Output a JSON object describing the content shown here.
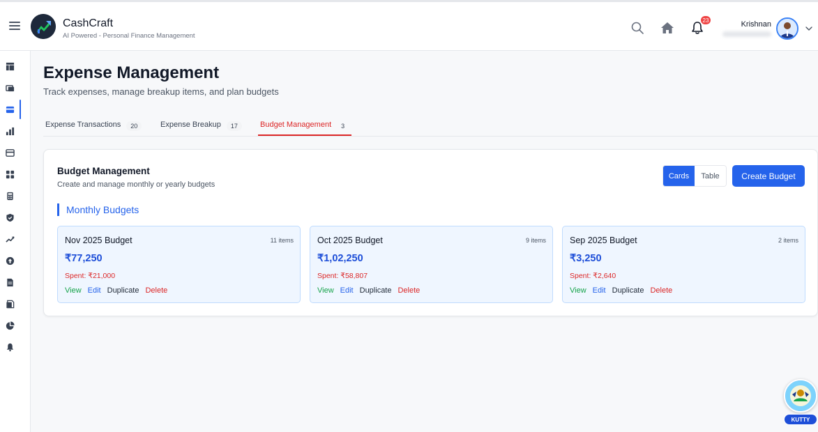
{
  "app": {
    "name": "CashCraft",
    "tagline": "AI Powered - Personal Finance Management"
  },
  "header": {
    "notification_count": "23",
    "user_name": "Krishnan",
    "icons": [
      "search-icon",
      "home-icon",
      "bell-icon",
      "chevron-down-icon"
    ]
  },
  "sidebar": {
    "items": [
      {
        "icon": "dashboard-icon"
      },
      {
        "icon": "wallet-icon"
      },
      {
        "icon": "credit-card-icon",
        "active": true
      },
      {
        "icon": "bar-chart-icon"
      },
      {
        "icon": "card-icon"
      },
      {
        "icon": "grid-icon"
      },
      {
        "icon": "calculator-icon"
      },
      {
        "icon": "shield-icon"
      },
      {
        "icon": "trending-up-icon"
      },
      {
        "icon": "upload-icon"
      },
      {
        "icon": "document-icon"
      },
      {
        "icon": "folder-icon"
      },
      {
        "icon": "pie-chart-icon"
      },
      {
        "icon": "bell-icon"
      }
    ]
  },
  "page": {
    "title": "Expense Management",
    "subtitle": "Track expenses, manage breakup items, and plan budgets"
  },
  "tabs": [
    {
      "label": "Expense Transactions",
      "count": "20"
    },
    {
      "label": "Expense Breakup",
      "count": "17"
    },
    {
      "label": "Budget Management",
      "count": "3",
      "active": true
    }
  ],
  "budget": {
    "title": "Budget Management",
    "subtitle": "Create and manage monthly or yearly budgets",
    "view_cards": "Cards",
    "view_table": "Table",
    "create_label": "Create Budget",
    "section_title": "Monthly Budgets",
    "cards": [
      {
        "title": "Nov 2025 Budget",
        "items": "11 items",
        "amount": "₹77,250",
        "spent": "Spent: ₹21,000"
      },
      {
        "title": "Oct 2025 Budget",
        "items": "9 items",
        "amount": "₹1,02,250",
        "spent": "Spent: ₹58,807"
      },
      {
        "title": "Sep 2025 Budget",
        "items": "2 items",
        "amount": "₹3,250",
        "spent": "Spent: ₹2,640"
      }
    ],
    "actions": {
      "view": "View",
      "edit": "Edit",
      "duplicate": "Duplicate",
      "delete": "Delete"
    }
  },
  "assistant": {
    "label": "KUTTY"
  },
  "colors": {
    "primary": "#2563eb",
    "danger": "#dc2626",
    "success": "#16a34a",
    "card_bg": "#eff6ff",
    "badge": "#ef4444"
  }
}
